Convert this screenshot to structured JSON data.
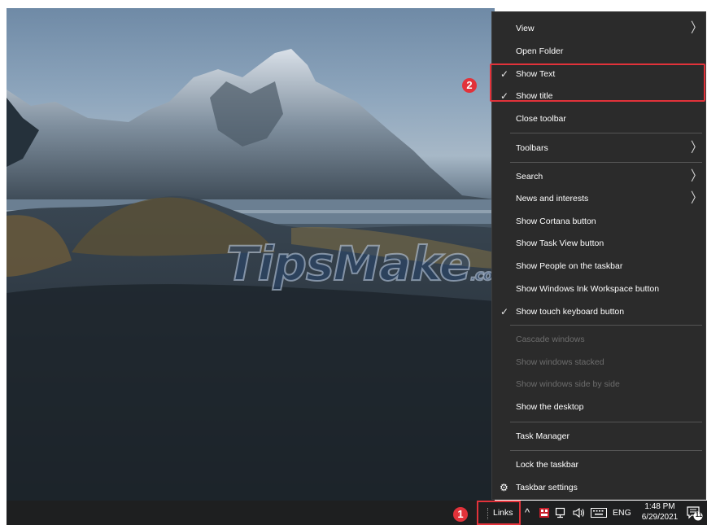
{
  "watermark": {
    "text": "TipsMake",
    "suffix": ".com"
  },
  "context_menu": {
    "items": [
      {
        "label": "View",
        "submenu": true
      },
      {
        "label": "Open Folder"
      },
      {
        "label": "Show Text",
        "checked": true
      },
      {
        "label": "Show title",
        "checked": true
      },
      {
        "label": "Close toolbar"
      },
      {
        "label": "Toolbars",
        "submenu": true
      },
      {
        "label": "Search",
        "submenu": true
      },
      {
        "label": "News and interests",
        "submenu": true
      },
      {
        "label": "Show Cortana button"
      },
      {
        "label": "Show Task View button"
      },
      {
        "label": "Show People on the taskbar"
      },
      {
        "label": "Show Windows Ink Workspace button"
      },
      {
        "label": "Show touch keyboard button",
        "checked": true
      },
      {
        "label": "Cascade windows",
        "disabled": true
      },
      {
        "label": "Show windows stacked",
        "disabled": true
      },
      {
        "label": "Show windows side by side",
        "disabled": true
      },
      {
        "label": "Show the desktop"
      },
      {
        "label": "Task Manager"
      },
      {
        "label": "Lock the taskbar"
      },
      {
        "label": "Taskbar settings",
        "icon": "gear-icon"
      }
    ],
    "check_glyph": "✓",
    "arrow_glyph": "〉"
  },
  "annotations": {
    "step1": "1",
    "step2": "2",
    "highlight_color": "#e2323a"
  },
  "taskbar": {
    "links_label": "Links",
    "chevron": "^",
    "language": "ENG",
    "time": "1:48 PM",
    "date": "6/29/2021",
    "notification_count": "11"
  }
}
